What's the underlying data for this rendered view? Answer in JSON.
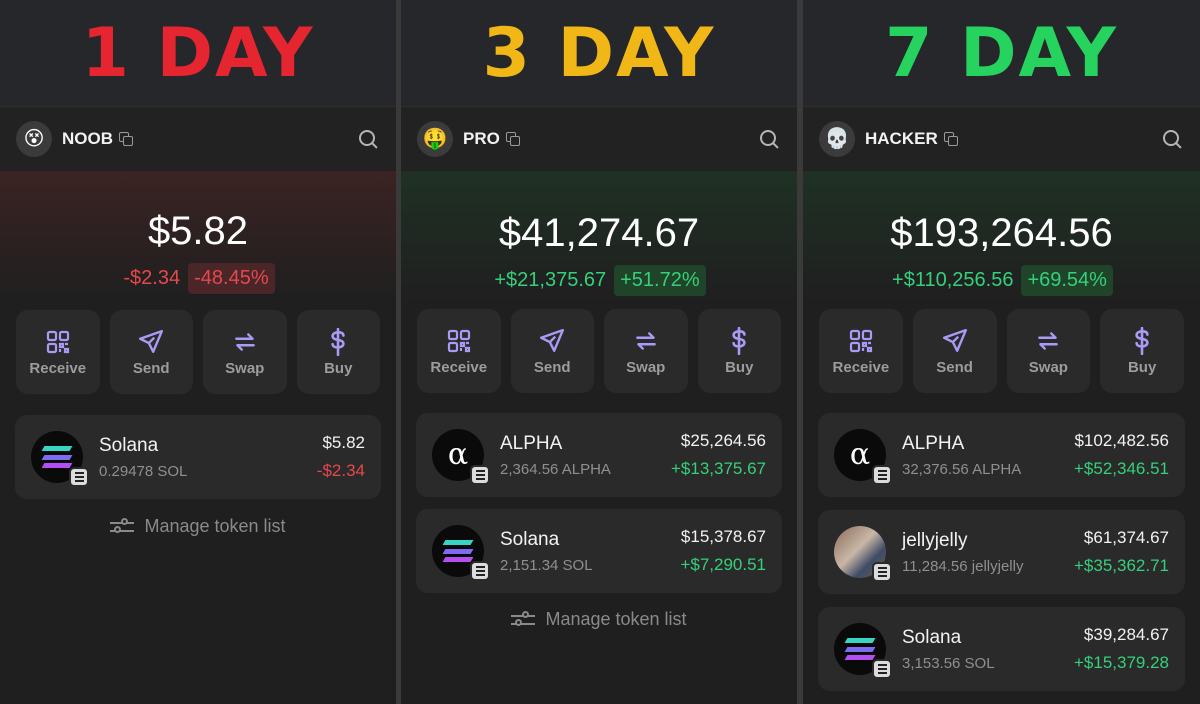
{
  "panels": [
    {
      "banner": "1 DAY",
      "banner_color": "#e5252f",
      "account": {
        "avatar": "😵",
        "name": "NOOB"
      },
      "theme": "red",
      "balance": "$5.82",
      "change_usd": "-$2.34",
      "change_pct": "-48.45%",
      "actions": [
        "Receive",
        "Send",
        "Swap",
        "Buy"
      ],
      "tokens": [
        {
          "name": "Solana",
          "amount": "0.29478 SOL",
          "value": "$5.82",
          "change": "-$2.34",
          "logo": "solana-logo"
        }
      ],
      "manage_label": "Manage token list"
    },
    {
      "banner": "3 DAY",
      "banner_color": "#f0b716",
      "account": {
        "avatar": "🤑",
        "name": "PRO"
      },
      "theme": "green",
      "balance": "$41,274.67",
      "change_usd": "+$21,375.67",
      "change_pct": "+51.72%",
      "actions": [
        "Receive",
        "Send",
        "Swap",
        "Buy"
      ],
      "tokens": [
        {
          "name": "ALPHA",
          "amount": "2,364.56 ALPHA",
          "value": "$25,264.56",
          "change": "+$13,375.67",
          "logo": "alpha-logo"
        },
        {
          "name": "Solana",
          "amount": "2,151.34 SOL",
          "value": "$15,378.67",
          "change": "+$7,290.51",
          "logo": "solana-logo"
        }
      ],
      "manage_label": "Manage token list"
    },
    {
      "banner": "7 DAY",
      "banner_color": "#27d35f",
      "account": {
        "avatar": "💀",
        "name": "HACKER"
      },
      "theme": "green",
      "balance": "$193,264.56",
      "change_usd": "+$110,256.56",
      "change_pct": "+69.54%",
      "actions": [
        "Receive",
        "Send",
        "Swap",
        "Buy"
      ],
      "tokens": [
        {
          "name": "ALPHA",
          "amount": "32,376.56 ALPHA",
          "value": "$102,482.56",
          "change": "+$52,346.51",
          "logo": "alpha-logo"
        },
        {
          "name": "jellyjelly",
          "amount": "11,284.56 jellyjelly",
          "value": "$61,374.67",
          "change": "+$35,362.71",
          "logo": "jellyjelly-avatar"
        },
        {
          "name": "Solana",
          "amount": "3,153.56 SOL",
          "value": "$39,284.67",
          "change": "+$15,379.28",
          "logo": "solana-logo"
        }
      ],
      "manage_label": ""
    }
  ],
  "colors": {
    "positive": "#35d07a",
    "negative": "#e5484d",
    "action_icon": "#a99bf5"
  }
}
